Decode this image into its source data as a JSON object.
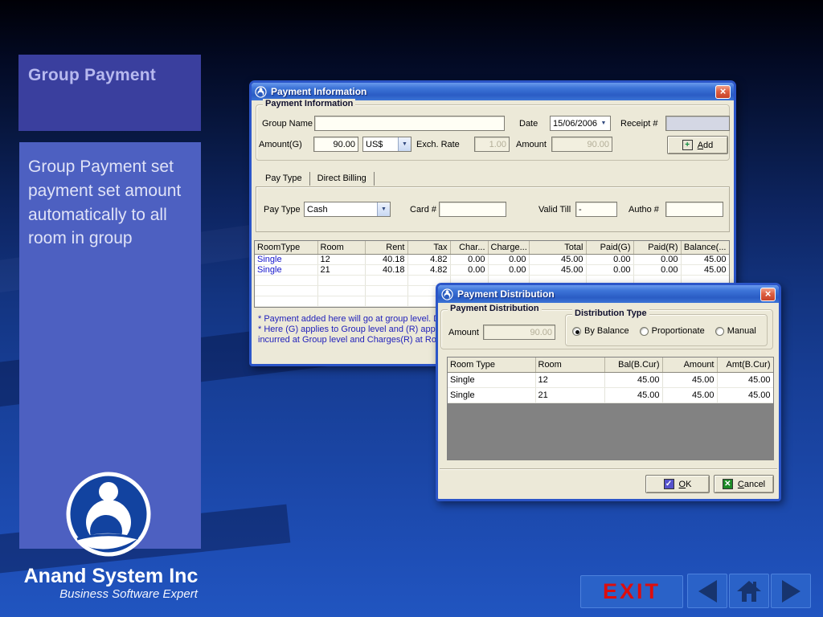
{
  "slide": {
    "title": "Group Payment",
    "description": "Group Payment set payment set amount automatically  to all room in group",
    "brand": {
      "name": "Anand System Inc",
      "tagline": "Business Software Expert"
    },
    "nav": {
      "exit_label": "EXIT"
    }
  },
  "colors": {
    "background_bottom": "#2155c0",
    "title_box": "#3a3f9e",
    "desc_box": "#4d60c1",
    "window_body": "#ece9d8",
    "titlebar_blue": "#3d74d8",
    "exit_red": "#dd0d0d",
    "note_blue": "#2222bb",
    "roomtype_link_blue": "#1414cc",
    "empty_grid_gray": "#828282"
  },
  "icons": {
    "close": "×",
    "dropdown": "▼",
    "ok_check": "✓",
    "cancel_x": "✕",
    "add_plus": "+"
  },
  "payment_information": {
    "window_title": "Payment Information",
    "group_box_label": "Payment Information",
    "fields": {
      "group_name_label": "Group Name",
      "group_name_value": "",
      "date_label": "Date",
      "date_value": "15/06/2006",
      "receipt_label": "Receipt #",
      "receipt_value": "",
      "amount_g_label": "Amount(G)",
      "amount_g_value": "90.00",
      "currency_value": "US$",
      "exch_rate_label": "Exch. Rate",
      "exch_rate_value": "1.00",
      "amount_label": "Amount",
      "amount_value": "90.00",
      "add_button": "Add"
    },
    "tabs": [
      "Pay Type",
      "Direct Billing"
    ],
    "pay_type_panel": {
      "pay_type_label": "Pay Type",
      "pay_type_value": "Cash",
      "card_label": "Card #",
      "card_value": "",
      "valid_till_label": "Valid Till",
      "valid_till_value": "-",
      "autho_label": "Autho #",
      "autho_value": ""
    },
    "table": {
      "columns": [
        "RoomType",
        "Room",
        "Rent",
        "Tax",
        "Char...",
        "Charge...",
        "Total",
        "Paid(G)",
        "Paid(R)",
        "Balance(..."
      ],
      "rows": [
        [
          "Single",
          "12",
          "40.18",
          "4.82",
          "0.00",
          "0.00",
          "45.00",
          "0.00",
          "0.00",
          "45.00"
        ],
        [
          "Single",
          "21",
          "40.18",
          "4.82",
          "0.00",
          "0.00",
          "45.00",
          "0.00",
          "0.00",
          "45.00"
        ]
      ]
    },
    "notes": [
      "* Payment added here will go at group level. Dou",
      "* Here (G) applies to Group level and (R) applies t",
      "incurred at Group level and Charges(R) at Room"
    ]
  },
  "payment_distribution": {
    "window_title": "Payment Distribution",
    "group_box_label": "Payment Distribution",
    "amount_label": "Amount",
    "amount_value": "90.00",
    "distribution_type": {
      "label": "Distribution Type",
      "options": [
        "By Balance",
        "Proportionate",
        "Manual"
      ],
      "selected": "By Balance"
    },
    "table": {
      "columns": [
        "Room Type",
        "Room",
        "Bal(B.Cur)",
        "Amount",
        "Amt(B.Cur)"
      ],
      "rows": [
        [
          "Single",
          "12",
          "45.00",
          "45.00",
          "45.00"
        ],
        [
          "Single",
          "21",
          "45.00",
          "45.00",
          "45.00"
        ]
      ]
    },
    "buttons": {
      "ok": "OK",
      "cancel": "Cancel"
    }
  }
}
